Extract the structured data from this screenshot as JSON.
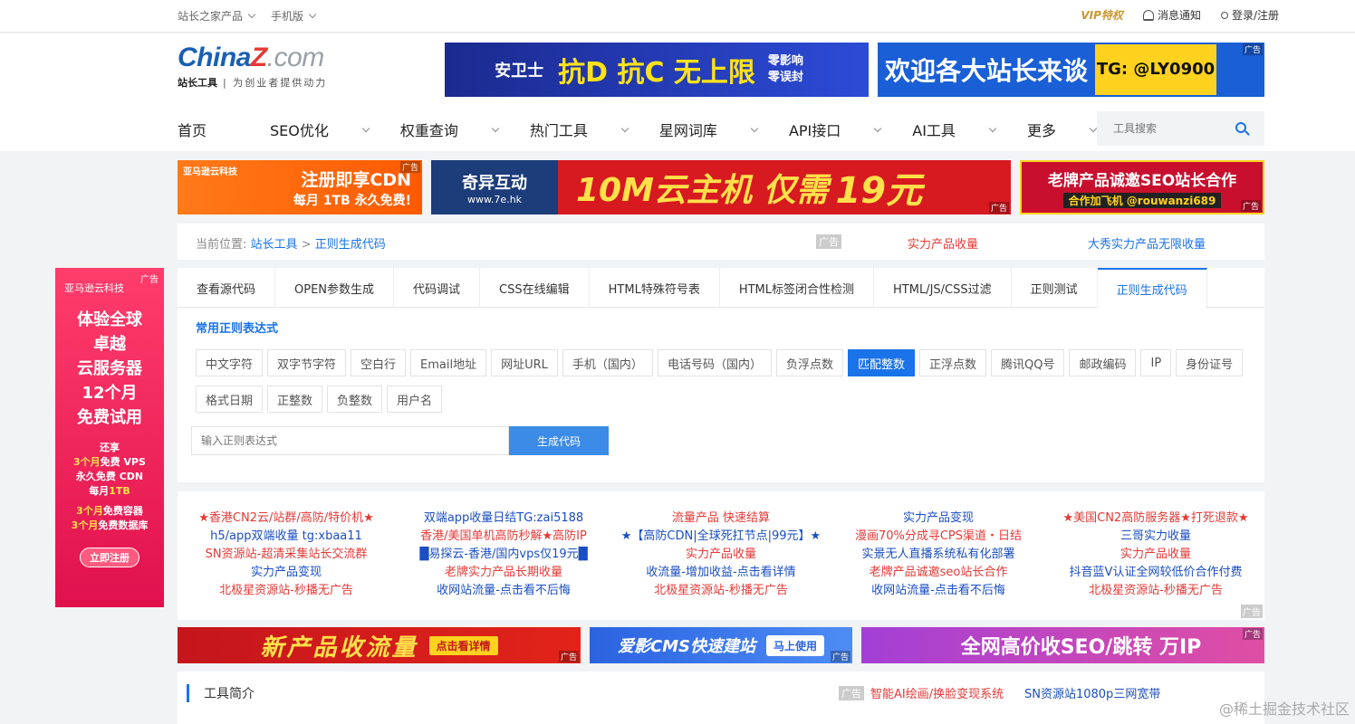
{
  "topbar": {
    "products": "站长之家产品",
    "mobile": "手机版",
    "vip": "VIP特权",
    "notify": "消息通知",
    "login": "登录/注册"
  },
  "logo": {
    "brand_a": "China",
    "brand_z": "Z",
    "brand_b": ".com",
    "sub_bold": "站长工具",
    "sub": "| 为创业者提供动力"
  },
  "header_ads": {
    "ad1_brand": "安卫士",
    "ad1_main": "抗D 抗C 无上限",
    "ad1_side": "零影响 零误封",
    "ad2_main": "欢迎各大站长来谈",
    "ad2_tg": "TG: @LY0900",
    "tag": "广告"
  },
  "nav": {
    "items": [
      "首页",
      "SEO优化",
      "权重查询",
      "热门工具",
      "星网词库",
      "API接口",
      "AI工具",
      "更多"
    ],
    "search_placeholder": "工具搜索"
  },
  "banner_ads": {
    "a1_brand": "亚马逊云科技",
    "a1_l1": "注册即享CDN",
    "a1_l2": "每月 1TB 永久免费!",
    "a2_brand": "奇异互动",
    "a2_url": "www.7e.hk",
    "a2_main": "10M云主机 仅需",
    "a2_price": "19元",
    "a3_l1": "老牌产品诚邀SEO站长合作",
    "a3_l2": "合作加飞机 @rouwanzi689",
    "tag": "广告"
  },
  "breadcrumb": {
    "label": "当前位置:",
    "home": "站长工具",
    "sep": ">",
    "current": "正则生成代码",
    "adtag": "广告",
    "ad_r1": "实力产品收量",
    "ad_r2": "大秀实力产品无限收量"
  },
  "side_ad": {
    "brand": "亚马逊云科技",
    "tag": "广告",
    "big": [
      "体验全球",
      "卓越",
      "云服务器",
      "12个月",
      "免费试用"
    ],
    "also": "还享",
    "l1_y": "3个月",
    "l1": "免费 VPS",
    "l2": "永久免费 CDN",
    "l3a": "每月",
    "l3_y": "1TB",
    "l4_y": "3个月",
    "l4": "免费容器",
    "l5_y": "3个月",
    "l5": "免费数据库",
    "btn": "立即注册"
  },
  "tabs": [
    "查看源代码",
    "OPEN参数生成",
    "代码调试",
    "CSS在线编辑",
    "HTML特殊符号表",
    "HTML标签闭合性检测",
    "HTML/JS/CSS过滤",
    "正则测试",
    "正则生成代码"
  ],
  "section_title": "常用正则表达式",
  "chips": [
    "中文字符",
    "双字节字符",
    "空白行",
    "Email地址",
    "网址URL",
    "手机（国内）",
    "电话号码（国内）",
    "负浮点数",
    "匹配整数",
    "正浮点数",
    "腾讯QQ号",
    "邮政编码",
    "IP",
    "身份证号",
    "格式日期",
    "正整数",
    "负整数",
    "用户名"
  ],
  "active_chip": "匹配整数",
  "regex": {
    "placeholder": "输入正则表达式",
    "button": "生成代码"
  },
  "link_cols": [
    [
      {
        "t": "★香港CN2云/站群/高防/特价机★",
        "c": "red"
      },
      {
        "t": "h5/app双端收量 tg:xbaa11",
        "c": "blue"
      },
      {
        "t": "SN资源站-超清采集站长交流群",
        "c": "red"
      },
      {
        "t": "实力产品变现",
        "c": "blue"
      },
      {
        "t": "北极星资源站-秒播无广告",
        "c": "red"
      }
    ],
    [
      {
        "t": "双端app收量日结TG:zai5188",
        "c": "blue"
      },
      {
        "t": "香港/美国单机高防秒解★高防IP",
        "c": "red"
      },
      {
        "t": "█易探云-香港/国内vps仅19元█",
        "c": "blue"
      },
      {
        "t": "老牌实力产品长期收量",
        "c": "red"
      },
      {
        "t": "收网站流量-点击看不后悔",
        "c": "blue"
      }
    ],
    [
      {
        "t": "流量产品 快速结算",
        "c": "red"
      },
      {
        "t": "★【高防CDN|全球死扛节点|99元】★",
        "c": "blue"
      },
      {
        "t": "实力产品收量",
        "c": "red"
      },
      {
        "t": "收流量-增加收益-点击看详情",
        "c": "blue"
      },
      {
        "t": "北极星资源站-秒播无广告",
        "c": "red"
      }
    ],
    [
      {
        "t": "实力产品变现",
        "c": "blue"
      },
      {
        "t": "漫画70%分成寻CPS渠道・日结",
        "c": "red"
      },
      {
        "t": "实景无人直播系统私有化部署",
        "c": "blue"
      },
      {
        "t": "老牌产品诚邀seo站长合作",
        "c": "red"
      },
      {
        "t": "收网站流量-点击看不后悔",
        "c": "blue"
      }
    ],
    [
      {
        "t": "★美国CN2高防服务器★打死退款★",
        "c": "red"
      },
      {
        "t": "三哥实力收量",
        "c": "blue"
      },
      {
        "t": "实力产品收量",
        "c": "red"
      },
      {
        "t": "抖音蓝V认证全网较低价合作付费",
        "c": "blue"
      },
      {
        "t": "北极星资源站-秒播无广告",
        "c": "red"
      }
    ]
  ],
  "links_adtag": "广告",
  "bottom_ads": {
    "b1": "新产品收流量",
    "b1_btn": "点击看详情",
    "b2": "爱影CMS快速建站",
    "b2_btn": "马上使用",
    "b3": "全网高价收SEO/跳转 万IP",
    "tag": "广告"
  },
  "intro": {
    "title": "工具简介",
    "adtag": "广告",
    "a1": "智能AI绘画/换脸变现系统",
    "a2": "SN资源站1080p三网宽带"
  },
  "watermark": "@稀土掘金技术社区",
  "colors": {
    "accent": "#1a73e8",
    "red": "#e53935",
    "link_blue": "#1a4ec2"
  }
}
